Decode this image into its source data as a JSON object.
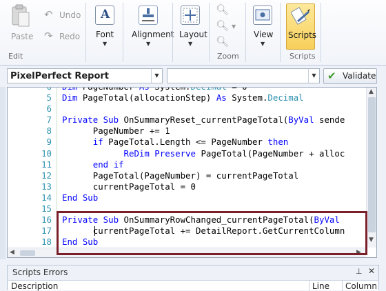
{
  "ribbon": {
    "edit": {
      "paste_label": "Paste",
      "undo_label": "Undo",
      "redo_label": "Redo",
      "group_label": "Edit"
    },
    "font_label": "Font",
    "alignment_label": "Alignment",
    "layout_label": "Layout",
    "zoom": {
      "group_label": "Zoom"
    },
    "view_label": "View",
    "scripts": {
      "button_label": "Scripts",
      "group_label": "Scripts"
    }
  },
  "toolbar": {
    "object_combo_value": "PixelPerfect  Report",
    "event_combo_value": "",
    "validate_label": "Validate"
  },
  "editor": {
    "lines": [
      {
        "num": "5",
        "segments": [
          {
            "t": "Dim ",
            "c": "kw"
          },
          {
            "t": "PageTotal(allocationStep) ",
            "c": ""
          },
          {
            "t": "As ",
            "c": "kw"
          },
          {
            "t": "System.",
            "c": ""
          },
          {
            "t": "Decimal",
            "c": "ty"
          }
        ]
      },
      {
        "num": "6",
        "segments": []
      },
      {
        "num": "7",
        "segments": [
          {
            "t": "Private Sub ",
            "c": "kw"
          },
          {
            "t": "OnSummaryReset_currentPageTotal(",
            "c": ""
          },
          {
            "t": "ByVal ",
            "c": "kw"
          },
          {
            "t": "sende",
            "c": ""
          }
        ]
      },
      {
        "num": "8",
        "segments": [
          {
            "t": "      PageNumber += 1",
            "c": ""
          }
        ]
      },
      {
        "num": "9",
        "segments": [
          {
            "t": "      ",
            "c": ""
          },
          {
            "t": "if ",
            "c": "kw"
          },
          {
            "t": "PageTotal.Length <= PageNumber ",
            "c": ""
          },
          {
            "t": "then",
            "c": "kw"
          }
        ]
      },
      {
        "num": "10",
        "segments": [
          {
            "t": "            ",
            "c": ""
          },
          {
            "t": "ReDim Preserve ",
            "c": "kw"
          },
          {
            "t": "PageTotal(PageNumber + alloc",
            "c": ""
          }
        ]
      },
      {
        "num": "11",
        "segments": [
          {
            "t": "      ",
            "c": ""
          },
          {
            "t": "end if",
            "c": "kw"
          }
        ]
      },
      {
        "num": "12",
        "segments": [
          {
            "t": "      PageTotal(PageNumber) = currentPageTotal",
            "c": ""
          }
        ]
      },
      {
        "num": "13",
        "segments": [
          {
            "t": "      currentPageTotal = 0",
            "c": ""
          }
        ]
      },
      {
        "num": "14",
        "segments": [
          {
            "t": "End Sub",
            "c": "kw"
          }
        ]
      },
      {
        "num": "15",
        "segments": []
      },
      {
        "num": "16",
        "segments": [
          {
            "t": "Private Sub ",
            "c": "kw"
          },
          {
            "t": "OnSummaryRowChanged_currentPageTotal(",
            "c": ""
          },
          {
            "t": "ByVal",
            "c": "kw"
          }
        ]
      },
      {
        "num": "17",
        "segments": [
          {
            "t": "      currentPageTotal += DetailReport.GetCurrentColumn",
            "c": ""
          }
        ]
      },
      {
        "num": "18",
        "segments": [
          {
            "t": "End Sub",
            "c": "kw"
          }
        ]
      }
    ]
  },
  "errors_panel": {
    "title": "Scripts Errors",
    "columns": [
      "Description",
      "Line",
      "Column"
    ]
  },
  "colors": {
    "keyword": "#0000ff",
    "type": "#2b91af",
    "line_number": "#2b91af",
    "highlight_border": "#7a1f2a",
    "scripts_active": "#f7cf5a"
  }
}
